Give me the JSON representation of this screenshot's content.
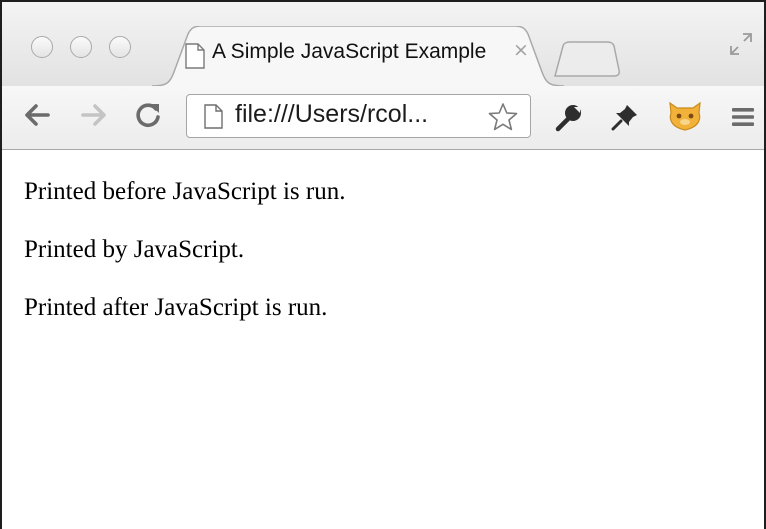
{
  "window": {
    "traffic_lights": [
      "close",
      "minimize",
      "zoom"
    ]
  },
  "tabs": [
    {
      "title": "A Simple JavaScript Example",
      "close_glyph": "×",
      "icon": "page-icon",
      "active": true
    }
  ],
  "toolbar": {
    "back_icon": "back-arrow-icon",
    "forward_icon": "forward-arrow-icon",
    "reload_icon": "reload-icon",
    "address": "file:///Users/rcol...",
    "bookmark_icon": "star-icon",
    "extensions": [
      "wrench-icon",
      "pin-icon",
      "avatar-icon"
    ],
    "menu_icon": "menu-icon"
  },
  "page": {
    "lines": [
      "Printed before JavaScript is run.",
      "Printed by JavaScript.",
      "Printed after JavaScript is run."
    ]
  },
  "colors": {
    "chrome_frame": "#e8e8e8",
    "toolbar": "#f1f1f1",
    "text": "#000000",
    "tab_close": "#a0a0a0",
    "avatar": "#f2b23a"
  }
}
